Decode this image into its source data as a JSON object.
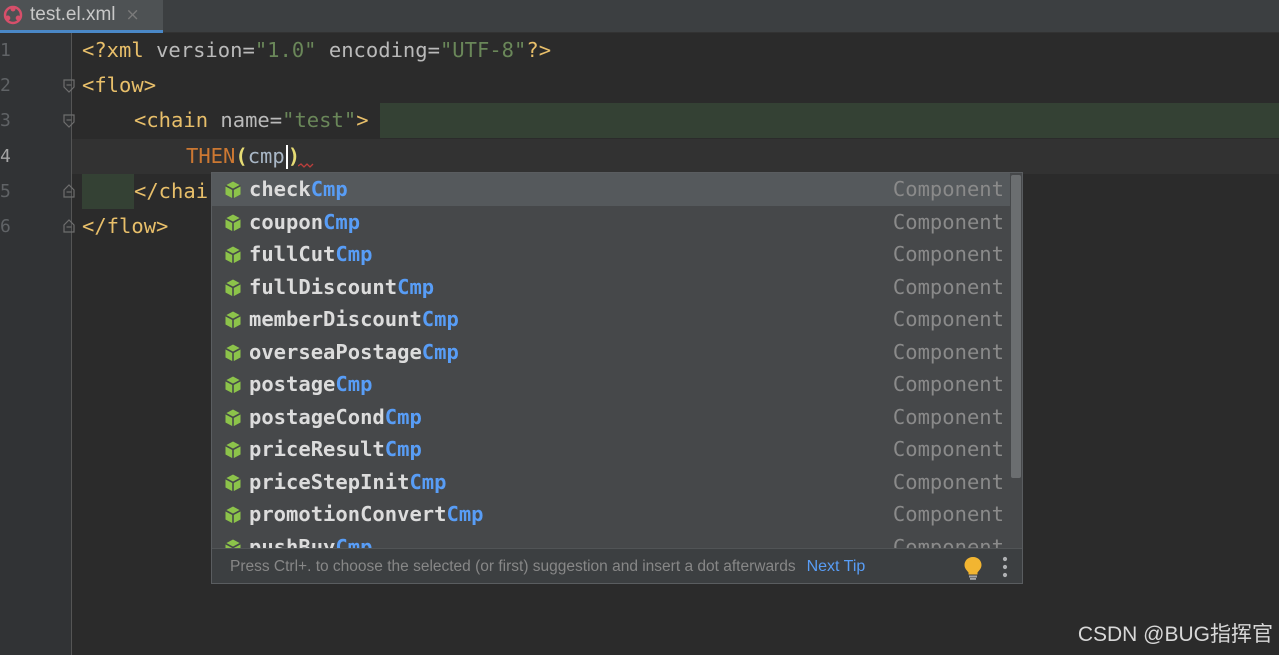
{
  "tab": {
    "title": "test.el.xml",
    "close": "×",
    "icon": "liteflow-logo-icon"
  },
  "gutter": {
    "line_numbers": [
      "1",
      "2",
      "3",
      "4",
      "5",
      "6"
    ]
  },
  "editor": {
    "line1": {
      "decl_open": "<?xml ",
      "attr1": "version=",
      "val1": "\"1.0\"",
      "attr2": " encoding=",
      "val2": "\"UTF-8\"",
      "decl_close": "?>"
    },
    "line2": {
      "tag": "<flow>"
    },
    "line3": {
      "tag_open": "<chain ",
      "attr": "name=",
      "val": "\"test\"",
      "tag_close": ">"
    },
    "line4": {
      "keyword": "THEN",
      "paren_open": "(",
      "text": "cmp",
      "paren_close": ")"
    },
    "line5": {
      "tag": "</chai"
    },
    "line6": {
      "tag": "</flow>"
    }
  },
  "completion": {
    "items": [
      {
        "prefix": "check",
        "match": "Cmp",
        "type": "Component"
      },
      {
        "prefix": "coupon",
        "match": "Cmp",
        "type": "Component"
      },
      {
        "prefix": "fullCut",
        "match": "Cmp",
        "type": "Component"
      },
      {
        "prefix": "fullDiscount",
        "match": "Cmp",
        "type": "Component"
      },
      {
        "prefix": "memberDiscount",
        "match": "Cmp",
        "type": "Component"
      },
      {
        "prefix": "overseaPostage",
        "match": "Cmp",
        "type": "Component"
      },
      {
        "prefix": "postage",
        "match": "Cmp",
        "type": "Component"
      },
      {
        "prefix": "postageCond",
        "match": "Cmp",
        "type": "Component"
      },
      {
        "prefix": "priceResult",
        "match": "Cmp",
        "type": "Component"
      },
      {
        "prefix": "priceStepInit",
        "match": "Cmp",
        "type": "Component"
      },
      {
        "prefix": "promotionConvert",
        "match": "Cmp",
        "type": "Component"
      },
      {
        "prefix": "pushBuy",
        "match": "Cmp",
        "type": "Component"
      }
    ],
    "footer_hint": "Press Ctrl+. to choose the selected (or first) suggestion and insert a dot afterwards",
    "next_tip": "Next Tip",
    "item_icon": "component-cube-icon",
    "colors": {
      "match": "#589df6",
      "icon": "#8cc34a",
      "selected_bg": "#55595c"
    }
  },
  "watermark": "CSDN @BUG指挥官"
}
